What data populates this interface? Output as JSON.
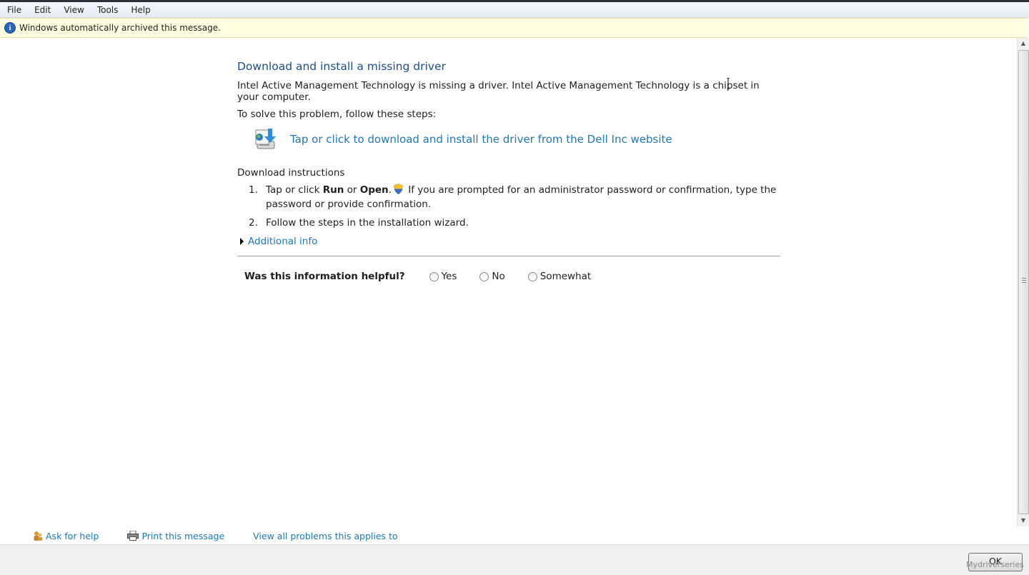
{
  "menu": [
    "File",
    "Edit",
    "View",
    "Tools",
    "Help"
  ],
  "infobar": {
    "text": "Windows automatically archived this message.",
    "icon": "info-icon"
  },
  "content": {
    "title": "Download and install a missing driver",
    "description": "Intel Active Management Technology is missing a driver. Intel Active Management Technology is a chipset in your computer.",
    "solve_text": "To solve this problem, follow these steps:",
    "download_link": "Tap or click to download and install the driver from the Dell Inc website",
    "instructions_title": "Download instructions",
    "steps": [
      {
        "num": "1.",
        "pre": "Tap or click ",
        "bold1": "Run",
        "mid": " or ",
        "bold2": "Open",
        "after": ".",
        "post": " If you are prompted for an administrator password or confirmation, type the password or provide confirmation."
      },
      {
        "num": "2.",
        "text": "Follow the steps in the installation wizard."
      }
    ],
    "additional_info": "Additional info",
    "feedback": {
      "question": "Was this information helpful?",
      "options": [
        "Yes",
        "No",
        "Somewhat"
      ]
    }
  },
  "footer_links": {
    "ask_help": "Ask for help",
    "print": "Print this message",
    "view_all": "View all problems this applies to"
  },
  "ok_button": "OK",
  "watermark": "Mydriverseries",
  "colors": {
    "link": "#1f78b4",
    "title": "#1b4f8d",
    "infobar_bg": "#ffffe1"
  }
}
